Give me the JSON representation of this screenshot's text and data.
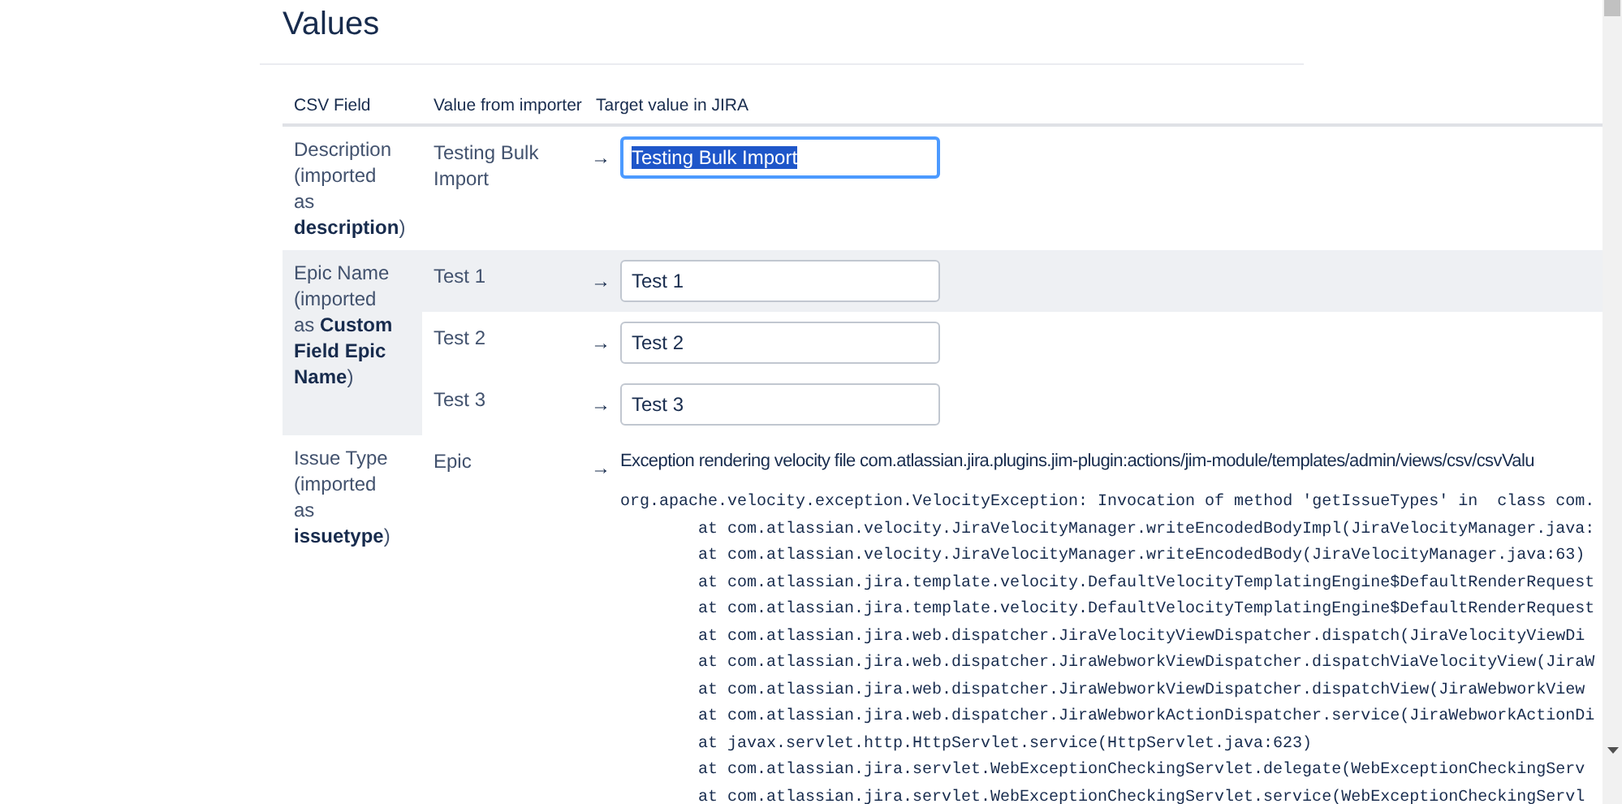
{
  "page": {
    "title": "Values"
  },
  "table": {
    "columns": [
      "CSV Field",
      "Value from importer",
      "Target value in JIRA"
    ],
    "rows": [
      {
        "csv_field": "Description (imported as **description**)",
        "highlighted": false,
        "values": [
          {
            "importer_value": "Testing Bulk Import",
            "arrow": "→",
            "target": {
              "kind": "input",
              "value": "Testing Bulk Import",
              "focused": true
            }
          }
        ]
      },
      {
        "csv_field": "Epic Name (imported as **Custom Field Epic Name**)",
        "highlighted": true,
        "values": [
          {
            "importer_value": "Test 1",
            "arrow": "→",
            "target": {
              "kind": "input",
              "value": "Test 1",
              "focused": false
            }
          },
          {
            "importer_value": "Test 2",
            "arrow": "→",
            "target": {
              "kind": "input",
              "value": "Test 2",
              "focused": false
            }
          },
          {
            "importer_value": "Test 3",
            "arrow": "→",
            "target": {
              "kind": "input",
              "value": "Test 3",
              "focused": false
            }
          }
        ]
      },
      {
        "csv_field": "Issue Type (imported as **issuetype**)",
        "highlighted": false,
        "values": [
          {
            "importer_value": "Epic",
            "arrow": "→",
            "target": {
              "kind": "error",
              "message": "Exception rendering velocity file com.atlassian.jira.plugins.jim-plugin:actions/jim-module/templates/admin/views/csv/csvValu",
              "trace_head": "org.apache.velocity.exception.VelocityException: Invocation of method 'getIssueTypes' in  class com.",
              "trace_frames": [
                "at com.atlassian.velocity.JiraVelocityManager.writeEncodedBodyImpl(JiraVelocityManager.java:",
                "at com.atlassian.velocity.JiraVelocityManager.writeEncodedBody(JiraVelocityManager.java:63)",
                "at com.atlassian.jira.template.velocity.DefaultVelocityTemplatingEngine$DefaultRenderRequest",
                "at com.atlassian.jira.template.velocity.DefaultVelocityTemplatingEngine$DefaultRenderRequest",
                "at com.atlassian.jira.web.dispatcher.JiraVelocityViewDispatcher.dispatch(JiraVelocityViewDi",
                "at com.atlassian.jira.web.dispatcher.JiraWebworkViewDispatcher.dispatchViaVelocityView(JiraW",
                "at com.atlassian.jira.web.dispatcher.JiraWebworkViewDispatcher.dispatchView(JiraWebworkView",
                "at com.atlassian.jira.web.dispatcher.JiraWebworkActionDispatcher.service(JiraWebworkActionDi",
                "at javax.servlet.http.HttpServlet.service(HttpServlet.java:623)",
                "at com.atlassian.jira.servlet.WebExceptionCheckingServlet.delegate(WebExceptionCheckingServ",
                "at com.atlassian.jira.servlet.WebExceptionCheckingServlet.service(WebExceptionCheckingServl"
              ]
            }
          }
        ]
      }
    ]
  }
}
